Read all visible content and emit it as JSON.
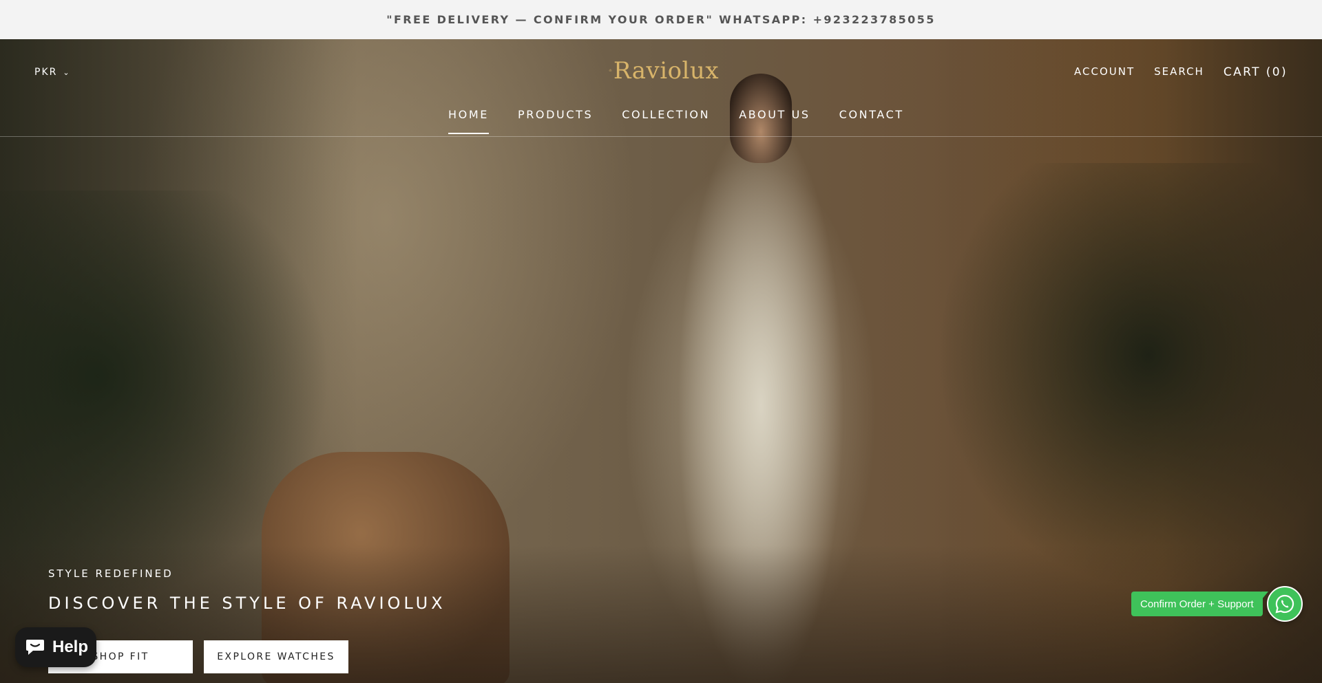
{
  "announcement": {
    "text": "\"FREE DELIVERY — CONFIRM YOUR ORDER\"   WHATSAPP: +923223785055"
  },
  "header": {
    "currency": "PKR",
    "logo_text": "Raviolux",
    "account": "ACCOUNT",
    "search": "SEARCH",
    "cart": "CART (0)"
  },
  "nav": {
    "items": [
      {
        "label": "HOME"
      },
      {
        "label": "PRODUCTS"
      },
      {
        "label": "COLLECTION"
      },
      {
        "label": "ABOUT US"
      },
      {
        "label": "CONTACT"
      }
    ],
    "active": "HOME"
  },
  "hero": {
    "eyebrow": "STYLE REDEFINED",
    "headline": "DISCOVER THE STYLE OF RAVIOLUX",
    "cta_primary": "SHOP FIT",
    "cta_secondary": "EXPLORE WATCHES"
  },
  "widgets": {
    "help_label": "Help",
    "whatsapp_label": "Confirm Order + Support"
  },
  "colors": {
    "announcement_bg": "#f3f3f3",
    "logo_gold": "#d8b46a",
    "whatsapp_green": "#3fc25a",
    "help_bg": "#1a1a1a"
  },
  "icons": [
    "chevron-down-icon",
    "crown-icon",
    "chat-bubble-icon",
    "whatsapp-icon"
  ]
}
